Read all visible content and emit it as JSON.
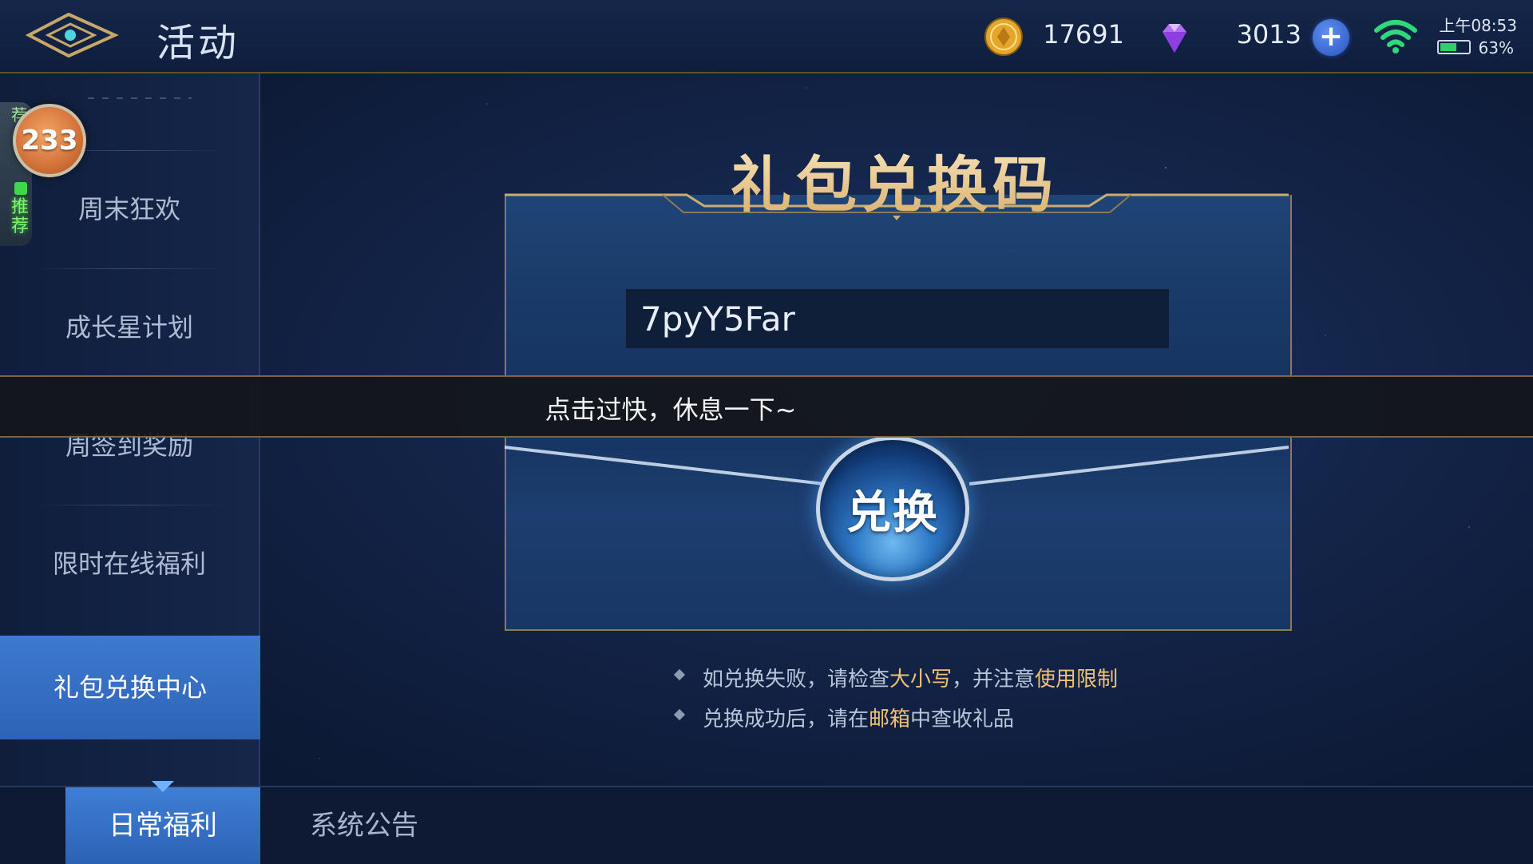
{
  "header": {
    "title": "活动",
    "coins": "17691",
    "gems": "3013",
    "clock": "上午08:53",
    "battery": "63%",
    "battery_level_percent": 63
  },
  "recommend": {
    "count": "233",
    "label_top": "荐",
    "label_vertical": "推荐"
  },
  "sidebar": {
    "items": [
      {
        "label": "周末狂欢"
      },
      {
        "label": "成长星计划"
      },
      {
        "label": "周签到奖励"
      },
      {
        "label": "限时在线福利"
      },
      {
        "label": "礼包兑换中心"
      }
    ],
    "active_index": 4
  },
  "main": {
    "title": "礼包兑换码",
    "code_value": "7pyY5Far",
    "redeem_label": "兑换",
    "tips": [
      {
        "prefix": "如兑换失败，请检查",
        "hl1": "大小写",
        "mid": "，并注意",
        "hl2": "使用限制"
      },
      {
        "prefix": "兑换成功后，请在",
        "hl1": "邮箱",
        "mid": "中查收礼品",
        "hl2": ""
      }
    ]
  },
  "toast": {
    "text": "点击过快，休息一下~"
  },
  "tabs": [
    {
      "label": "日常福利",
      "active": true
    },
    {
      "label": "系统公告",
      "active": false
    }
  ],
  "colors": {
    "accent_blue": "#3d7ad0",
    "gold": "#f0c276",
    "frame_border": "#8a7a55"
  }
}
